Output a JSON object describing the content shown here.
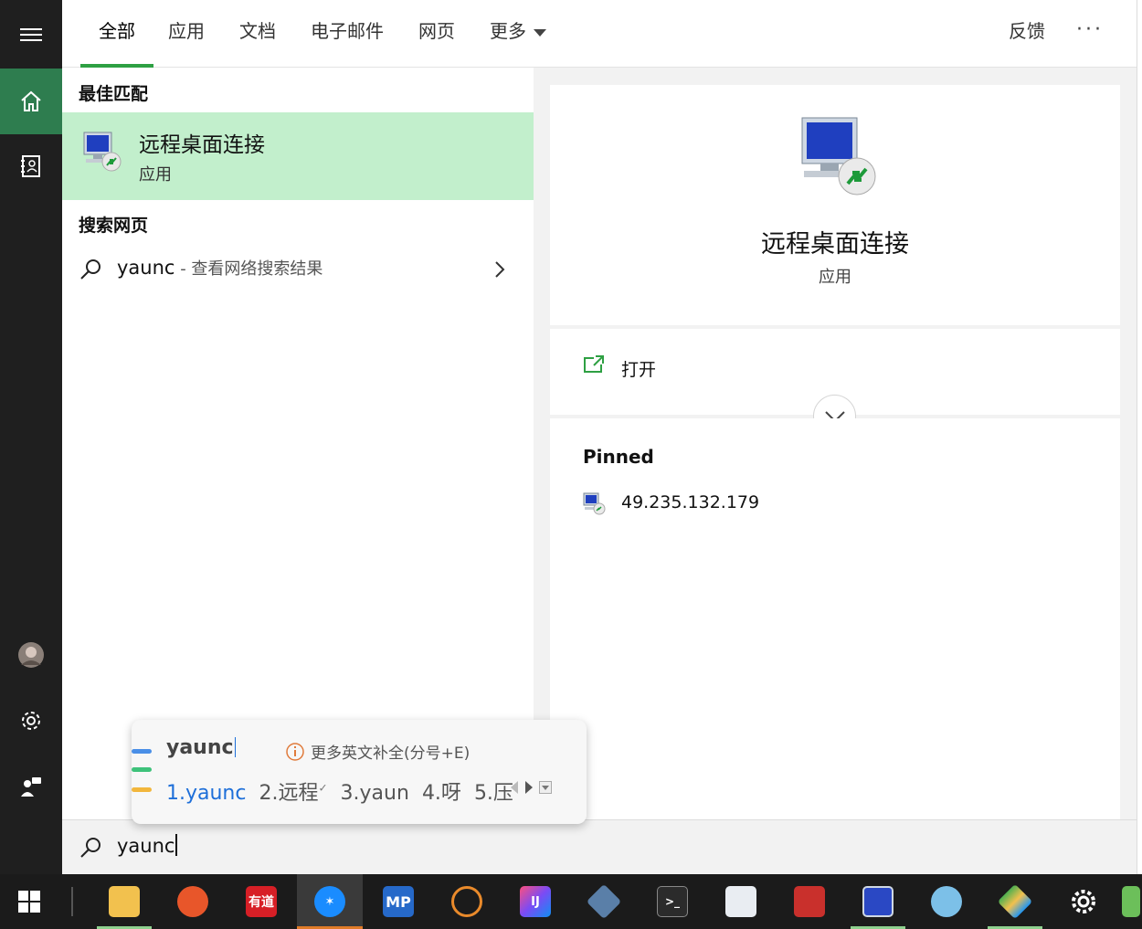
{
  "tabs": [
    "全部",
    "应用",
    "文档",
    "电子邮件",
    "网页",
    "更多"
  ],
  "feedback_label": "反馈",
  "more_label": "···",
  "results": {
    "best_match_header": "最佳匹配",
    "best_match": {
      "title": "远程桌面连接",
      "subtitle": "应用"
    },
    "web_header": "搜索网页",
    "web_item": {
      "query": "yaunc",
      "hint": " - 查看网络搜索结果"
    }
  },
  "detail": {
    "title": "远程桌面连接",
    "subtitle": "应用",
    "open_label": "打开",
    "pinned_header": "Pinned",
    "pinned_items": [
      "49.235.132.179"
    ]
  },
  "ime": {
    "composition": "yaunc",
    "tip": "更多英文补全(分号+E)",
    "candidates": [
      "1.yaunc",
      "2.远程",
      "3.yaun",
      "4.呀",
      "5.压"
    ]
  },
  "search": {
    "query": "yaunc"
  },
  "taskbar_items": [
    "windows-start",
    "file-explorer",
    "firefox",
    "youdao",
    "dingtalk",
    "mp",
    "davinci",
    "intellij",
    "virtualbox",
    "terminal",
    "notepad",
    "redis",
    "remote-desktop",
    "cloud",
    "git",
    "settings"
  ]
}
